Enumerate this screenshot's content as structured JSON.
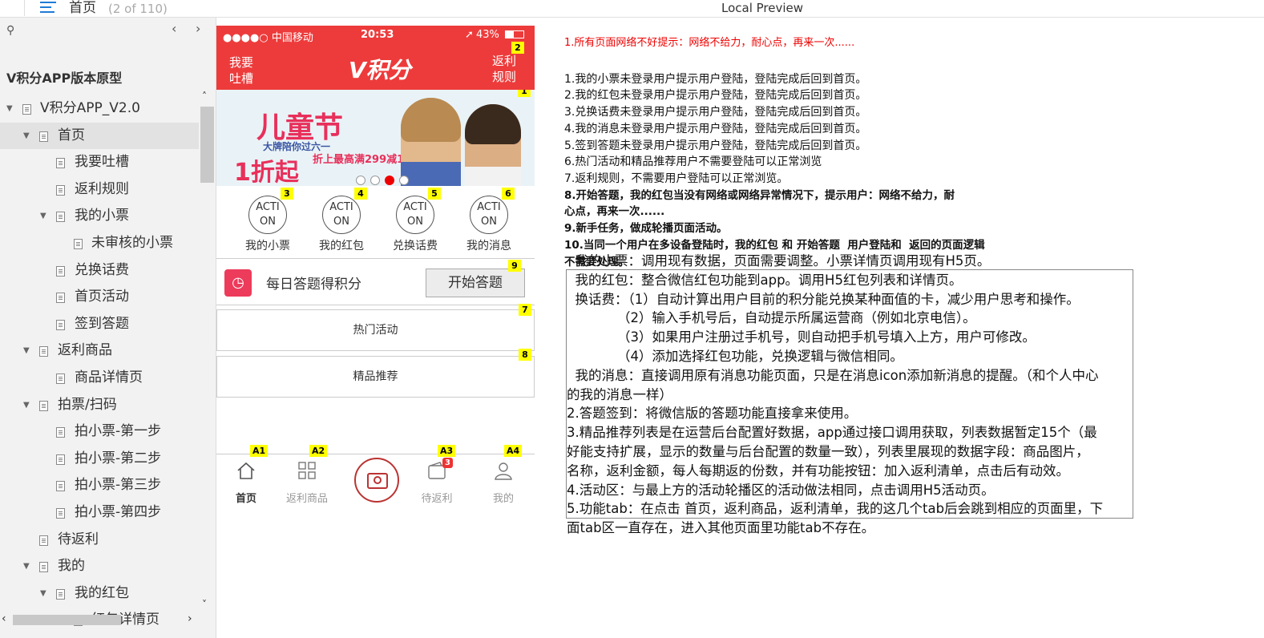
{
  "topbar": {
    "page_name": "首页",
    "page_count": "(2 of 110)",
    "title": "Local Preview"
  },
  "sidebar": {
    "project_title": "V积分APP版本原型",
    "tree": [
      {
        "label": "V积分APP_V2.0",
        "level": 0,
        "arrow": true,
        "selected": false
      },
      {
        "label": "首页",
        "level": 1,
        "arrow": true,
        "selected": true
      },
      {
        "label": "我要吐槽",
        "level": 2,
        "arrow": false,
        "selected": false
      },
      {
        "label": "返利规则",
        "level": 2,
        "arrow": false,
        "selected": false
      },
      {
        "label": "我的小票",
        "level": 2,
        "arrow": true,
        "selected": false
      },
      {
        "label": "未审核的小票",
        "level": 3,
        "arrow": false,
        "selected": false
      },
      {
        "label": "兑换话费",
        "level": 2,
        "arrow": false,
        "selected": false
      },
      {
        "label": "首页活动",
        "level": 2,
        "arrow": false,
        "selected": false
      },
      {
        "label": "签到答题",
        "level": 2,
        "arrow": false,
        "selected": false
      },
      {
        "label": "返利商品",
        "level": 1,
        "arrow": true,
        "selected": false
      },
      {
        "label": "商品详情页",
        "level": 2,
        "arrow": false,
        "selected": false
      },
      {
        "label": "拍票/扫码",
        "level": 1,
        "arrow": true,
        "selected": false
      },
      {
        "label": "拍小票-第一步",
        "level": 2,
        "arrow": false,
        "selected": false
      },
      {
        "label": "拍小票-第二步",
        "level": 2,
        "arrow": false,
        "selected": false
      },
      {
        "label": "拍小票-第三步",
        "level": 2,
        "arrow": false,
        "selected": false
      },
      {
        "label": "拍小票-第四步",
        "level": 2,
        "arrow": false,
        "selected": false
      },
      {
        "label": "待返利",
        "level": 1,
        "arrow": false,
        "selected": false
      },
      {
        "label": "我的",
        "level": 1,
        "arrow": true,
        "selected": false
      },
      {
        "label": "我的红包",
        "level": 2,
        "arrow": true,
        "selected": false
      },
      {
        "label": "红包详情页",
        "level": 3,
        "arrow": false,
        "selected": false
      }
    ]
  },
  "phone": {
    "status": {
      "carrier": "●●●●○ 中国移动",
      "time": "20:53",
      "battery": "43%"
    },
    "nav": {
      "left": "我要吐槽",
      "logo": "V积分",
      "right": "返利规则",
      "badge": "2"
    },
    "banner": {
      "badge": "1",
      "title": "儿童节",
      "subtitle": "大牌陪你过六一",
      "discount": "1折起",
      "note": "折上最高满299减100"
    },
    "actions": [
      {
        "icon_text": "ACTION",
        "label": "我的小票",
        "badge": "3"
      },
      {
        "icon_text": "ACTION",
        "label": "我的红包",
        "badge": "4"
      },
      {
        "icon_text": "ACTION",
        "label": "兑换话费",
        "badge": "5"
      },
      {
        "icon_text": "ACTION",
        "label": "我的消息",
        "badge": "6"
      }
    ],
    "answer": {
      "text": "每日答题得积分",
      "button": "开始答题",
      "badge": "9"
    },
    "hot": {
      "label": "热门活动",
      "badge": "7"
    },
    "featured": {
      "label": "精品推荐",
      "badge": "8"
    },
    "tabs": [
      {
        "label": "首页",
        "badge": "A1",
        "icon": "home-icon"
      },
      {
        "label": "返利商品",
        "badge": "A2",
        "icon": "grid-icon"
      },
      {
        "label": "",
        "badge": "",
        "icon": "camera-icon"
      },
      {
        "label": "待返利",
        "badge": "A3",
        "icon": "wallet-icon",
        "count": "3"
      },
      {
        "label": "我的",
        "badge": "A4",
        "icon": "user-icon"
      }
    ]
  },
  "notes": {
    "warning": "1.所有页面网络不好提示：网络不给力，耐心点，再来一次......",
    "lines": [
      "1.我的小票未登录用户提示用户登陆，登陆完成后回到首页。",
      "2.我的红包未登录用户提示用户登陆，登陆完成后回到首页。",
      "3.兑换话费未登录用户提示用户登陆，登陆完成后回到首页。",
      "4.我的消息未登录用户提示用户登陆，登陆完成后回到首页。",
      "5.签到答题未登录用户提示用户登陆，登陆完成后回到首页。",
      "6.热门活动和精品推荐用户不需要登陆可以正常浏览",
      "7.返利规则，不需要用户登陆可以正常浏览。"
    ],
    "bold_lines": [
      "8.开始答题，我的红包当没有网络或网络异常情况下，提示用户：网络不给力，耐",
      "心点，再来一次......",
      "9.新手任务，做成轮播页面活动。",
      "10.当同一个用户在多设备登陆时，我的红包 和 开始答题  用户登陆和  返回的页面逻辑",
      "不需要处理。"
    ]
  },
  "spec": [
    "  我的小票：调用现有数据，页面需要调整。小票详情页调用现有H5页。",
    "  我的红包：整合微信红包功能到app。调用H5红包列表和详情页。",
    "  换话费：（1）自动计算出用户目前的积分能兑换某种面值的卡，减少用户思考和操作。",
    "            （2）输入手机号后，自动提示所属运营商（例如北京电信）。",
    "            （3）如果用户注册过手机号，则自动把手机号填入上方，用户可修改。",
    "            （4）添加选择红包功能，兑换逻辑与微信相同。",
    "  我的消息：直接调用原有消息功能页面，只是在消息icon添加新消息的提醒。（和个人中心",
    "的我的消息一样）",
    "2.答题签到：将微信版的答题功能直接拿来使用。",
    "3.精品推荐列表是在运营后台配置好数据，app通过接口调用获取，列表数据暂定15个（最",
    "好能支持扩展，显示的数量与后台配置的数量一致），列表里展现的数据字段：商品图片，",
    "名称，返利金额，每人每期返的份数，并有功能按钮：加入返利清单，点击后有动效。",
    "4.活动区：与最上方的活动轮播区的活动做法相同，点击调用H5活动页。",
    "5.功能tab：在点击 首页，返利商品，返利清单，我的这几个tab后会跳到相应的页面里，下",
    "面tab区一直存在，进入其他页面里功能tab不存在。"
  ]
}
